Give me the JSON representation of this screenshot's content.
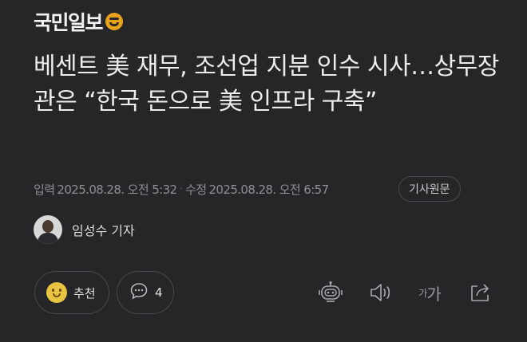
{
  "brand": {
    "name": "국민일보",
    "accent": "#e8a21a"
  },
  "article": {
    "headline": "베센트 美 재무, 조선업 지분 인수 시사…상무장관은 “한국 돈으로 美 인프라 구축”",
    "published_label": "입력",
    "published": "2025.08.28. 오전 5:32",
    "updated_label": "수정",
    "updated": "2025.08.28. 오전 6:57",
    "separator": "·",
    "source_button": "기사원문"
  },
  "author": {
    "name": "임성수 기자"
  },
  "actions": {
    "like_label": "추천",
    "comment_count": "4",
    "font_size_small": "가",
    "font_size_large": "가"
  },
  "icons": [
    "smiley-icon",
    "comment-icon",
    "robot-icon",
    "speaker-icon",
    "share-icon"
  ]
}
